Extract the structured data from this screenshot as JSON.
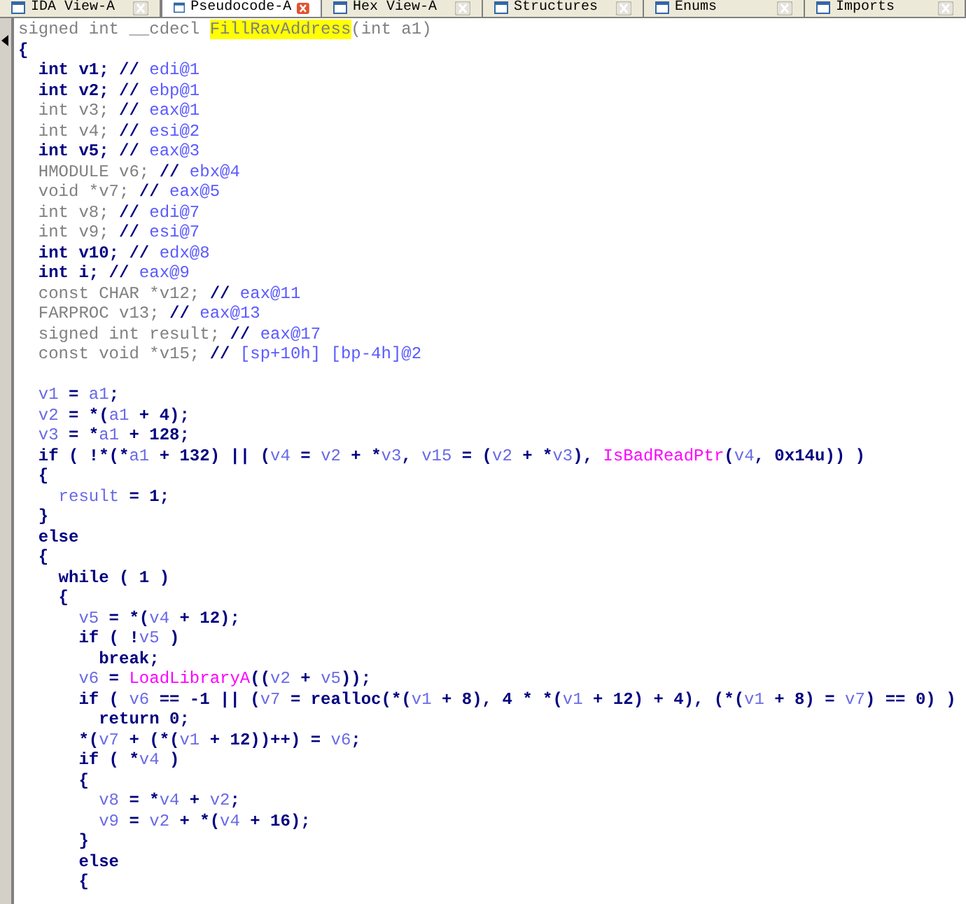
{
  "tabs": [
    {
      "label": "IDA View-A",
      "selected": false
    },
    {
      "label": "Pseudocode-A",
      "selected": true
    },
    {
      "label": "Hex View-A",
      "selected": false
    },
    {
      "label": "Structures",
      "selected": false
    },
    {
      "label": "Enums",
      "selected": false
    },
    {
      "label": "Imports",
      "selected": false
    }
  ],
  "code_lines": [
    {
      "kind": "code",
      "tokens": [
        {
          "kind": "dim",
          "text": "signed int __cdecl "
        },
        {
          "kind": "name",
          "text": "FillRavAddress"
        },
        {
          "kind": "dim",
          "text": "(int a1)"
        }
      ]
    },
    {
      "kind": "code",
      "tokens": [
        {
          "kind": "code",
          "text": "{"
        }
      ]
    },
    {
      "kind": "code",
      "tokens": [
        {
          "kind": "code",
          "text": "  int v1; //"
        },
        {
          "kind": "comment",
          "text": " edi@1"
        }
      ]
    },
    {
      "kind": "code",
      "tokens": [
        {
          "kind": "code",
          "text": "  int v2; //"
        },
        {
          "kind": "comment",
          "text": " ebp@1"
        }
      ]
    },
    {
      "kind": "code",
      "tokens": [
        {
          "kind": "dim",
          "text": "  int v3;"
        },
        {
          "kind": "code",
          "text": " //"
        },
        {
          "kind": "comment",
          "text": " eax@1"
        }
      ]
    },
    {
      "kind": "code",
      "tokens": [
        {
          "kind": "dim",
          "text": "  int v4;"
        },
        {
          "kind": "code",
          "text": " //"
        },
        {
          "kind": "comment",
          "text": " esi@2"
        }
      ]
    },
    {
      "kind": "code",
      "tokens": [
        {
          "kind": "code",
          "text": "  int v5; //"
        },
        {
          "kind": "comment",
          "text": " eax@3"
        }
      ]
    },
    {
      "kind": "code",
      "tokens": [
        {
          "kind": "dim",
          "text": "  HMODULE v6;"
        },
        {
          "kind": "code",
          "text": " //"
        },
        {
          "kind": "comment",
          "text": " ebx@4"
        }
      ]
    },
    {
      "kind": "code",
      "tokens": [
        {
          "kind": "dim",
          "text": "  void *v7;"
        },
        {
          "kind": "code",
          "text": " //"
        },
        {
          "kind": "comment",
          "text": " eax@5"
        }
      ]
    },
    {
      "kind": "code",
      "tokens": [
        {
          "kind": "dim",
          "text": "  int v8;"
        },
        {
          "kind": "code",
          "text": " //"
        },
        {
          "kind": "comment",
          "text": " edi@7"
        }
      ]
    },
    {
      "kind": "code",
      "tokens": [
        {
          "kind": "dim",
          "text": "  int v9;"
        },
        {
          "kind": "code",
          "text": " //"
        },
        {
          "kind": "comment",
          "text": " esi@7"
        }
      ]
    },
    {
      "kind": "code",
      "tokens": [
        {
          "kind": "code",
          "text": "  int v10; //"
        },
        {
          "kind": "comment",
          "text": " edx@8"
        }
      ]
    },
    {
      "kind": "code",
      "tokens": [
        {
          "kind": "code",
          "text": "  int i; //"
        },
        {
          "kind": "comment",
          "text": " eax@9"
        }
      ]
    },
    {
      "kind": "code",
      "tokens": [
        {
          "kind": "dim",
          "text": "  const CHAR *v12;"
        },
        {
          "kind": "code",
          "text": " //"
        },
        {
          "kind": "comment",
          "text": " eax@11"
        }
      ]
    },
    {
      "kind": "code",
      "tokens": [
        {
          "kind": "dim",
          "text": "  FARPROC v13;"
        },
        {
          "kind": "code",
          "text": " //"
        },
        {
          "kind": "comment",
          "text": " eax@13"
        }
      ]
    },
    {
      "kind": "code",
      "tokens": [
        {
          "kind": "dim",
          "text": "  signed int result;"
        },
        {
          "kind": "code",
          "text": " //"
        },
        {
          "kind": "comment",
          "text": " eax@17"
        }
      ]
    },
    {
      "kind": "code",
      "tokens": [
        {
          "kind": "dim",
          "text": "  const void *v15;"
        },
        {
          "kind": "code",
          "text": " //"
        },
        {
          "kind": "comment",
          "text": " [sp+10h] [bp-4h]@2"
        }
      ]
    },
    {
      "kind": "blank"
    },
    {
      "kind": "code",
      "tokens": [
        {
          "kind": "var",
          "text": "  v1"
        },
        {
          "kind": "code",
          "text": " = "
        },
        {
          "kind": "var",
          "text": "a1"
        },
        {
          "kind": "code",
          "text": ";"
        }
      ]
    },
    {
      "kind": "code",
      "tokens": [
        {
          "kind": "var",
          "text": "  v2"
        },
        {
          "kind": "code",
          "text": " = *("
        },
        {
          "kind": "var",
          "text": "a1"
        },
        {
          "kind": "code",
          "text": " + 4);"
        }
      ]
    },
    {
      "kind": "code",
      "tokens": [
        {
          "kind": "var",
          "text": "  v3"
        },
        {
          "kind": "code",
          "text": " = *"
        },
        {
          "kind": "var",
          "text": "a1"
        },
        {
          "kind": "code",
          "text": " + 128;"
        }
      ]
    },
    {
      "kind": "code",
      "tokens": [
        {
          "kind": "code",
          "text": "  if ( !*(*"
        },
        {
          "kind": "var",
          "text": "a1"
        },
        {
          "kind": "code",
          "text": " + 132) || ("
        },
        {
          "kind": "var",
          "text": "v4"
        },
        {
          "kind": "code",
          "text": " = "
        },
        {
          "kind": "var",
          "text": "v2"
        },
        {
          "kind": "code",
          "text": " + *"
        },
        {
          "kind": "var",
          "text": "v3"
        },
        {
          "kind": "code",
          "text": ", "
        },
        {
          "kind": "var",
          "text": "v15"
        },
        {
          "kind": "code",
          "text": " = ("
        },
        {
          "kind": "var",
          "text": "v2"
        },
        {
          "kind": "code",
          "text": " + *"
        },
        {
          "kind": "var",
          "text": "v3"
        },
        {
          "kind": "code",
          "text": "), "
        },
        {
          "kind": "func",
          "text": "IsBadReadPtr"
        },
        {
          "kind": "code",
          "text": "("
        },
        {
          "kind": "var",
          "text": "v4"
        },
        {
          "kind": "code",
          "text": ", 0x14u)) )"
        }
      ]
    },
    {
      "kind": "code",
      "tokens": [
        {
          "kind": "code",
          "text": "  {"
        }
      ]
    },
    {
      "kind": "code",
      "tokens": [
        {
          "kind": "var",
          "text": "    result"
        },
        {
          "kind": "code",
          "text": " = 1;"
        }
      ]
    },
    {
      "kind": "code",
      "tokens": [
        {
          "kind": "code",
          "text": "  }"
        }
      ]
    },
    {
      "kind": "code",
      "tokens": [
        {
          "kind": "code",
          "text": "  else"
        }
      ]
    },
    {
      "kind": "code",
      "tokens": [
        {
          "kind": "code",
          "text": "  {"
        }
      ]
    },
    {
      "kind": "code",
      "tokens": [
        {
          "kind": "code",
          "text": "    while ( 1 )"
        }
      ]
    },
    {
      "kind": "code",
      "tokens": [
        {
          "kind": "code",
          "text": "    {"
        }
      ]
    },
    {
      "kind": "code",
      "tokens": [
        {
          "kind": "var",
          "text": "      v5"
        },
        {
          "kind": "code",
          "text": " = *("
        },
        {
          "kind": "var",
          "text": "v4"
        },
        {
          "kind": "code",
          "text": " + 12);"
        }
      ]
    },
    {
      "kind": "code",
      "tokens": [
        {
          "kind": "code",
          "text": "      if ( !"
        },
        {
          "kind": "var",
          "text": "v5"
        },
        {
          "kind": "code",
          "text": " )"
        }
      ]
    },
    {
      "kind": "code",
      "tokens": [
        {
          "kind": "code",
          "text": "        break;"
        }
      ]
    },
    {
      "kind": "code",
      "tokens": [
        {
          "kind": "var",
          "text": "      v6"
        },
        {
          "kind": "code",
          "text": " = "
        },
        {
          "kind": "func",
          "text": "LoadLibraryA"
        },
        {
          "kind": "code",
          "text": "(("
        },
        {
          "kind": "var",
          "text": "v2"
        },
        {
          "kind": "code",
          "text": " + "
        },
        {
          "kind": "var",
          "text": "v5"
        },
        {
          "kind": "code",
          "text": "));"
        }
      ]
    },
    {
      "kind": "code",
      "tokens": [
        {
          "kind": "code",
          "text": "      if ( "
        },
        {
          "kind": "var",
          "text": "v6"
        },
        {
          "kind": "code",
          "text": " == -1 || ("
        },
        {
          "kind": "var",
          "text": "v7"
        },
        {
          "kind": "code",
          "text": " = realloc(*("
        },
        {
          "kind": "var",
          "text": "v1"
        },
        {
          "kind": "code",
          "text": " + 8), 4 * *("
        },
        {
          "kind": "var",
          "text": "v1"
        },
        {
          "kind": "code",
          "text": " + 12) + 4), (*("
        },
        {
          "kind": "var",
          "text": "v1"
        },
        {
          "kind": "code",
          "text": " + 8) = "
        },
        {
          "kind": "var",
          "text": "v7"
        },
        {
          "kind": "code",
          "text": ") == 0) )"
        }
      ]
    },
    {
      "kind": "code",
      "tokens": [
        {
          "kind": "code",
          "text": "        return 0;"
        }
      ]
    },
    {
      "kind": "code",
      "tokens": [
        {
          "kind": "code",
          "text": "      *("
        },
        {
          "kind": "var",
          "text": "v7"
        },
        {
          "kind": "code",
          "text": " + (*("
        },
        {
          "kind": "var",
          "text": "v1"
        },
        {
          "kind": "code",
          "text": " + 12))++) = "
        },
        {
          "kind": "var",
          "text": "v6"
        },
        {
          "kind": "code",
          "text": ";"
        }
      ]
    },
    {
      "kind": "code",
      "tokens": [
        {
          "kind": "code",
          "text": "      if ( *"
        },
        {
          "kind": "var",
          "text": "v4"
        },
        {
          "kind": "code",
          "text": " )"
        }
      ]
    },
    {
      "kind": "code",
      "tokens": [
        {
          "kind": "code",
          "text": "      {"
        }
      ]
    },
    {
      "kind": "code",
      "tokens": [
        {
          "kind": "var",
          "text": "        v8"
        },
        {
          "kind": "code",
          "text": " = *"
        },
        {
          "kind": "var",
          "text": "v4"
        },
        {
          "kind": "code",
          "text": " + "
        },
        {
          "kind": "var",
          "text": "v2"
        },
        {
          "kind": "code",
          "text": ";"
        }
      ]
    },
    {
      "kind": "code",
      "tokens": [
        {
          "kind": "var",
          "text": "        v9"
        },
        {
          "kind": "code",
          "text": " = "
        },
        {
          "kind": "var",
          "text": "v2"
        },
        {
          "kind": "code",
          "text": " + *("
        },
        {
          "kind": "var",
          "text": "v4"
        },
        {
          "kind": "code",
          "text": " + 16);"
        }
      ]
    },
    {
      "kind": "code",
      "tokens": [
        {
          "kind": "code",
          "text": "      }"
        }
      ]
    },
    {
      "kind": "code",
      "tokens": [
        {
          "kind": "code",
          "text": "      else"
        }
      ]
    },
    {
      "kind": "code",
      "tokens": [
        {
          "kind": "code",
          "text": "      {"
        }
      ]
    }
  ]
}
